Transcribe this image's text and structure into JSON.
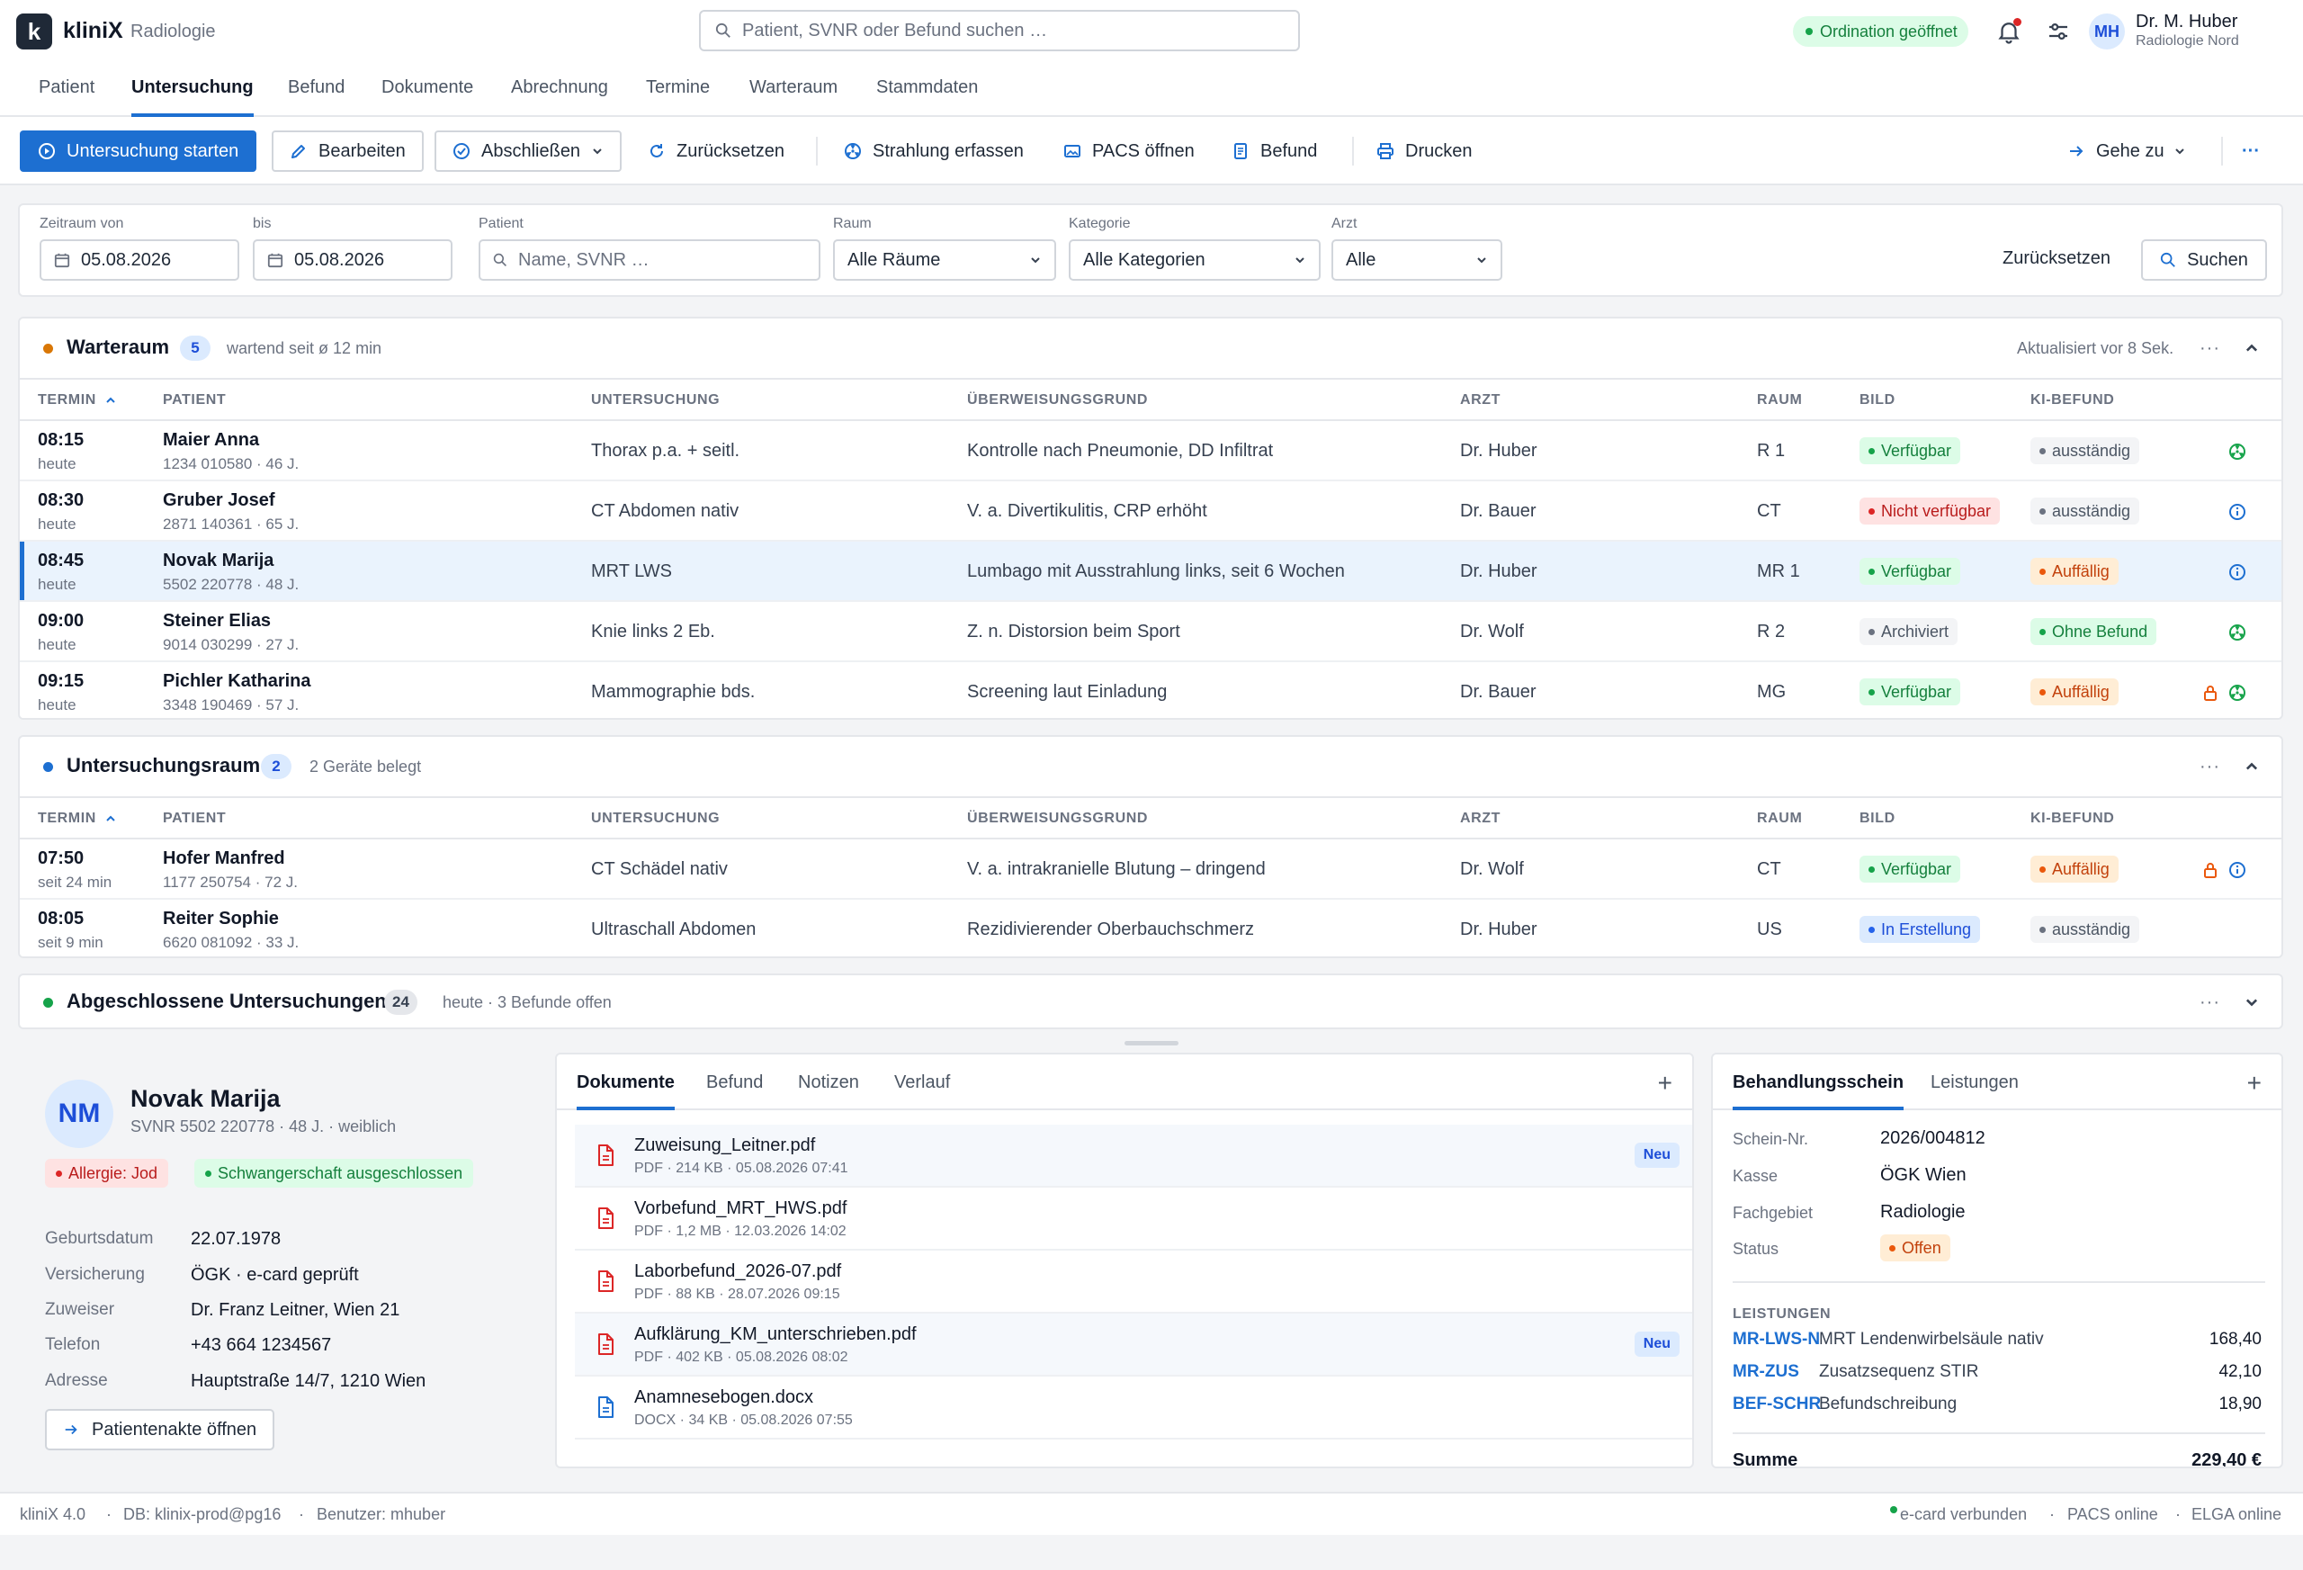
{
  "app": {
    "logo_letter": "k",
    "brand": "kliniX",
    "module": "Radiologie"
  },
  "header": {
    "search_placeholder": "Patient, SVNR oder Befund suchen …",
    "ordination_status": "Ordination geöffnet",
    "user_initials": "MH",
    "user_name": "Dr. M. Huber",
    "user_org": "Radiologie Nord"
  },
  "nav": {
    "tabs": [
      "Patient",
      "Untersuchung",
      "Befund",
      "Dokumente",
      "Abrechnung",
      "Termine",
      "Warteraum",
      "Stammdaten"
    ],
    "active": "Untersuchung"
  },
  "toolbar": {
    "start": "Untersuchung starten",
    "edit": "Bearbeiten",
    "finish": "Abschließen",
    "reset": "Zurücksetzen",
    "radiation": "Strahlung erfassen",
    "pacs": "PACS öffnen",
    "report": "Befund",
    "print": "Drucken",
    "goto": "Gehe zu",
    "more": "···"
  },
  "filters": {
    "from_label": "Zeitraum von",
    "from_value": "05.08.2026",
    "to_label": "bis",
    "to_value": "05.08.2026",
    "patient_label": "Patient",
    "patient_placeholder": "Name, SVNR …",
    "room_label": "Raum",
    "room_value": "Alle Räume",
    "category_label": "Kategorie",
    "category_value": "Alle Kategorien",
    "doctor_label": "Arzt",
    "doctor_value": "Alle",
    "reset": "Zurücksetzen",
    "search": "Suchen"
  },
  "columns": {
    "termin": "TERMIN",
    "patient": "PATIENT",
    "untersuchung": "UNTERSUCHUNG",
    "grund": "ÜBERWEISUNGSGRUND",
    "arzt": "ARZT",
    "raum": "RAUM",
    "bild": "BILD",
    "ki": "KI-BEFUND"
  },
  "waiting": {
    "title": "Warteraum",
    "count": "5",
    "meta": "wartend seit ø 12 min",
    "updated": "Aktualisiert vor 8 Sek.",
    "rows": [
      {
        "time": "08:15",
        "when": "heute",
        "name": "Maier Anna",
        "sub": "1234 010580 · 46 J.",
        "exam": "Thorax p.a. + seitl.",
        "reason": "Kontrolle nach Pneumonie, DD Infiltrat",
        "doctor": "Dr. Huber",
        "room": "R 1",
        "image": "Verfügbar",
        "image_color": "green",
        "ai": "ausständig",
        "ai_color": "gray",
        "icons": [
          "radiation-icon"
        ]
      },
      {
        "time": "08:30",
        "when": "heute",
        "name": "Gruber Josef",
        "sub": "2871 140361 · 65 J.",
        "exam": "CT Abdomen nativ",
        "reason": "V. a. Divertikulitis, CRP erhöht",
        "doctor": "Dr. Bauer",
        "room": "CT",
        "image": "Nicht verfügbar",
        "image_color": "red",
        "ai": "ausständig",
        "ai_color": "gray",
        "icons": [
          "info-icon"
        ]
      },
      {
        "time": "08:45",
        "when": "heute",
        "name": "Novak Marija",
        "sub": "5502 220778 · 48 J.",
        "exam": "MRT LWS",
        "reason": "Lumbago mit Ausstrahlung links, seit 6 Wochen",
        "doctor": "Dr. Huber",
        "room": "MR 1",
        "image": "Verfügbar",
        "image_color": "green",
        "ai": "Auffällig",
        "ai_color": "orange",
        "icons": [
          "info-icon"
        ],
        "selected": true
      },
      {
        "time": "09:00",
        "when": "heute",
        "name": "Steiner Elias",
        "sub": "9014 030299 · 27 J.",
        "exam": "Knie links 2 Eb.",
        "reason": "Z. n. Distorsion beim Sport",
        "doctor": "Dr. Wolf",
        "room": "R 2",
        "image": "Archiviert",
        "image_color": "gray",
        "ai": "Ohne Befund",
        "ai_color": "green",
        "icons": [
          "radiation-icon"
        ]
      },
      {
        "time": "09:15",
        "when": "heute",
        "name": "Pichler Katharina",
        "sub": "3348 190469 · 57 J.",
        "exam": "Mammographie bds.",
        "reason": "Screening laut Einladung",
        "doctor": "Dr. Bauer",
        "room": "MG",
        "image": "Verfügbar",
        "image_color": "green",
        "ai": "Auffällig",
        "ai_color": "orange",
        "icons": [
          "lock-icon",
          "radiation-icon"
        ]
      }
    ]
  },
  "examroom": {
    "title": "Untersuchungsraum",
    "count": "2",
    "meta": "2 Geräte belegt",
    "rows": [
      {
        "time": "07:50",
        "when": "seit 24 min",
        "name": "Hofer Manfred",
        "sub": "1177 250754 · 72 J.",
        "exam": "CT Schädel nativ",
        "reason": "V. a. intrakranielle Blutung – dringend",
        "doctor": "Dr. Wolf",
        "room": "CT",
        "image": "Verfügbar",
        "image_color": "green",
        "ai": "Auffällig",
        "ai_color": "orange",
        "icons": [
          "lock-icon",
          "info-icon"
        ]
      },
      {
        "time": "08:05",
        "when": "seit 9 min",
        "name": "Reiter Sophie",
        "sub": "6620 081092 · 33 J.",
        "exam": "Ultraschall Abdomen",
        "reason": "Rezidivierender Oberbauchschmerz",
        "doctor": "Dr. Huber",
        "room": "US",
        "image": "In Erstellung",
        "image_color": "blue",
        "ai": "ausständig",
        "ai_color": "gray",
        "icons": []
      }
    ]
  },
  "completed": {
    "title": "Abgeschlossene Untersuchungen",
    "count": "24",
    "meta": "heute · 3 Befunde offen"
  },
  "patient": {
    "initials": "NM",
    "name": "Novak Marija",
    "sub": "SVNR 5502 220778 · 48 J. · weiblich",
    "tag_allergy": "Allergie: Jod",
    "tag_preg": "Schwangerschaft ausgeschlossen",
    "fields": [
      {
        "k": "Geburtsdatum",
        "v": "22.07.1978"
      },
      {
        "k": "Versicherung",
        "v": "ÖGK · e-card geprüft"
      },
      {
        "k": "Zuweiser",
        "v": "Dr. Franz Leitner, Wien 21"
      },
      {
        "k": "Telefon",
        "v": "+43 664 1234567"
      },
      {
        "k": "Adresse",
        "v": "Hauptstraße 14/7, 1210 Wien"
      }
    ],
    "open_record": "Patientenakte öffnen"
  },
  "docs": {
    "tabs": [
      "Dokumente",
      "Befund",
      "Notizen",
      "Verlauf"
    ],
    "items": [
      {
        "name": "Zuweisung_Leitner.pdf",
        "meta": "PDF · 214 KB  ·  05.08.2026 07:41",
        "new": "Neu",
        "type": "pdf"
      },
      {
        "name": "Vorbefund_MRT_HWS.pdf",
        "meta": "PDF · 1,2 MB  ·  12.03.2026 14:02",
        "new": "",
        "type": "pdf"
      },
      {
        "name": "Laborbefund_2026-07.pdf",
        "meta": "PDF · 88 KB  ·  28.07.2026 09:15",
        "new": "",
        "type": "pdf"
      },
      {
        "name": "Aufklärung_KM_unterschrieben.pdf",
        "meta": "PDF · 402 KB  ·  05.08.2026 08:02",
        "new": "Neu",
        "type": "pdf"
      },
      {
        "name": "Anamnesebogen.docx",
        "meta": "DOCX · 34 KB  ·  05.08.2026 07:55",
        "new": "",
        "type": "docx"
      }
    ]
  },
  "billing": {
    "tabs": [
      "Behandlungsschein",
      "Leistungen"
    ],
    "fields": [
      {
        "k": "Schein-Nr.",
        "v": "2026/004812"
      },
      {
        "k": "Kasse",
        "v": "ÖGK Wien"
      },
      {
        "k": "Fachgebiet",
        "v": "Radiologie"
      }
    ],
    "status_label": "Status",
    "status": "Offen",
    "services_header": "LEISTUNGEN",
    "services": [
      {
        "code": "MR-LWS-N",
        "desc": "MRT Lendenwirbelsäule nativ",
        "amount": "168,40"
      },
      {
        "code": "MR-ZUS",
        "desc": "Zusatzsequenz STIR",
        "amount": "42,10"
      },
      {
        "code": "BEF-SCHR",
        "desc": "Befundschreibung",
        "amount": "18,90"
      }
    ],
    "sum_label": "Summe",
    "sum": "229,40 €"
  },
  "footer": {
    "version": "kliniX 4.0",
    "db": "DB: klinix-prod@pg16",
    "user": "Benutzer: mhuber",
    "ecard": "e-card verbunden",
    "pacs": "PACS online",
    "elga": "ELGA online"
  },
  "colors": {
    "accent": "#1d6fd1",
    "waiting_dot": "#d97706",
    "exam_dot": "#1d6fd1",
    "done_dot": "#16a34a"
  }
}
